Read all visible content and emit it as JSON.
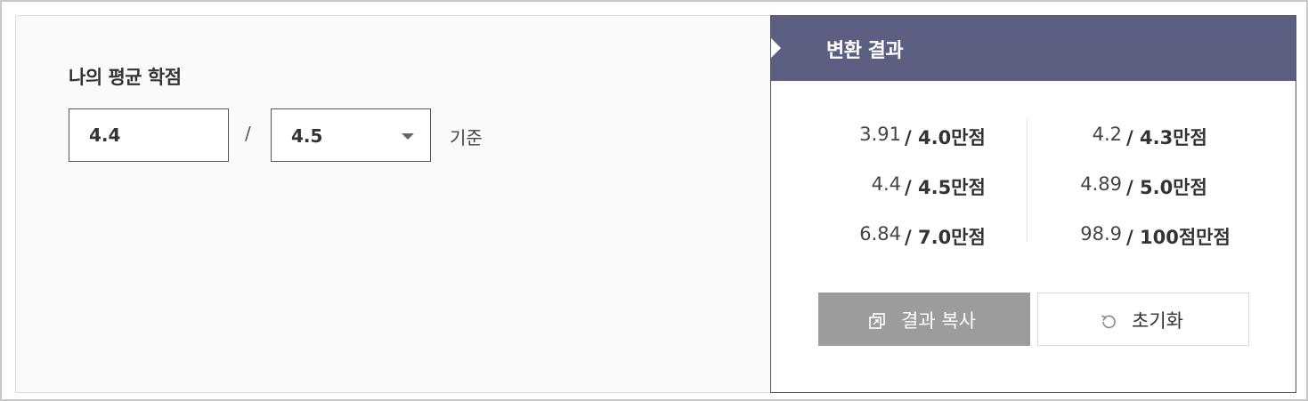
{
  "calculator": {
    "label": "나의 평균 학점",
    "grade_value": "4.4",
    "separator": "/",
    "scale_selected": "4.5",
    "basis_label": "기준"
  },
  "result": {
    "title": "변환 결과",
    "left_rows": [
      {
        "value": "3.91",
        "scale": "/ 4.0만점"
      },
      {
        "value": "4.4",
        "scale": "/ 4.5만점"
      },
      {
        "value": "6.84",
        "scale": "/ 7.0만점"
      }
    ],
    "right_rows": [
      {
        "value": "4.2",
        "scale": "/ 4.3만점"
      },
      {
        "value": "4.89",
        "scale": "/ 5.0만점"
      },
      {
        "value": "98.9",
        "scale": "/ 100점만점"
      }
    ],
    "copy_button": "결과 복사",
    "reset_button": "초기화"
  },
  "icons": {
    "copy": "copy-icon",
    "reset": "reset-icon",
    "dropdown": "chevron-down-icon"
  },
  "colors": {
    "header_bg": "#5c5f81",
    "copy_button_bg": "#9c9c9c",
    "panel_bg": "#fafafa"
  }
}
